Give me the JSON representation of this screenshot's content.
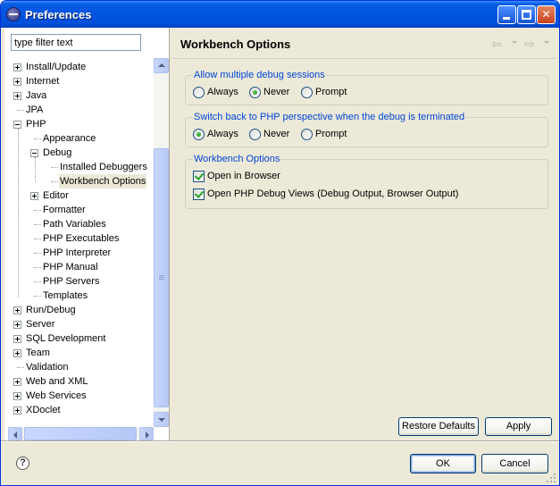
{
  "window": {
    "title": "Preferences"
  },
  "filter": {
    "placeholder": "type filter text",
    "value": "type filter text"
  },
  "tree": [
    {
      "label": "Install/Update",
      "level": 0,
      "expander": "plus"
    },
    {
      "label": "Internet",
      "level": 0,
      "expander": "plus"
    },
    {
      "label": "Java",
      "level": 0,
      "expander": "plus"
    },
    {
      "label": "JPA",
      "level": 0,
      "expander": "none"
    },
    {
      "label": "PHP",
      "level": 0,
      "expander": "minus"
    },
    {
      "label": "Appearance",
      "level": 1,
      "expander": "none"
    },
    {
      "label": "Debug",
      "level": 1,
      "expander": "minus"
    },
    {
      "label": "Installed Debuggers",
      "level": 2,
      "expander": "none"
    },
    {
      "label": "Workbench Options",
      "level": 2,
      "expander": "none",
      "selected": true
    },
    {
      "label": "Editor",
      "level": 1,
      "expander": "plus"
    },
    {
      "label": "Formatter",
      "level": 1,
      "expander": "none"
    },
    {
      "label": "Path Variables",
      "level": 1,
      "expander": "none"
    },
    {
      "label": "PHP Executables",
      "level": 1,
      "expander": "none"
    },
    {
      "label": "PHP Interpreter",
      "level": 1,
      "expander": "none"
    },
    {
      "label": "PHP Manual",
      "level": 1,
      "expander": "none"
    },
    {
      "label": "PHP Servers",
      "level": 1,
      "expander": "none"
    },
    {
      "label": "Templates",
      "level": 1,
      "expander": "none"
    },
    {
      "label": "Run/Debug",
      "level": 0,
      "expander": "plus"
    },
    {
      "label": "Server",
      "level": 0,
      "expander": "plus"
    },
    {
      "label": "SQL Development",
      "level": 0,
      "expander": "plus"
    },
    {
      "label": "Team",
      "level": 0,
      "expander": "plus"
    },
    {
      "label": "Validation",
      "level": 0,
      "expander": "none"
    },
    {
      "label": "Web and XML",
      "level": 0,
      "expander": "plus"
    },
    {
      "label": "Web Services",
      "level": 0,
      "expander": "plus"
    },
    {
      "label": "XDoclet",
      "level": 0,
      "expander": "plus"
    }
  ],
  "page": {
    "title": "Workbench Options",
    "back_icon": "back-arrow-icon",
    "forward_icon": "forward-arrow-icon"
  },
  "groups": {
    "multiple_sessions": {
      "title": "Allow multiple debug sessions",
      "options": [
        "Always",
        "Never",
        "Prompt"
      ],
      "selected": "Never"
    },
    "switch_perspective": {
      "title": "Switch back to PHP perspective when the debug is terminated",
      "options": [
        "Always",
        "Never",
        "Prompt"
      ],
      "selected": "Always"
    },
    "workbench": {
      "title": "Workbench Options",
      "checks": [
        {
          "label": "Open in Browser",
          "checked": true
        },
        {
          "label": "Open PHP Debug Views (Debug Output, Browser Output)",
          "checked": true
        }
      ]
    }
  },
  "buttons": {
    "restore_defaults": "Restore Defaults",
    "apply": "Apply",
    "ok": "OK",
    "cancel": "Cancel",
    "help": "?"
  }
}
